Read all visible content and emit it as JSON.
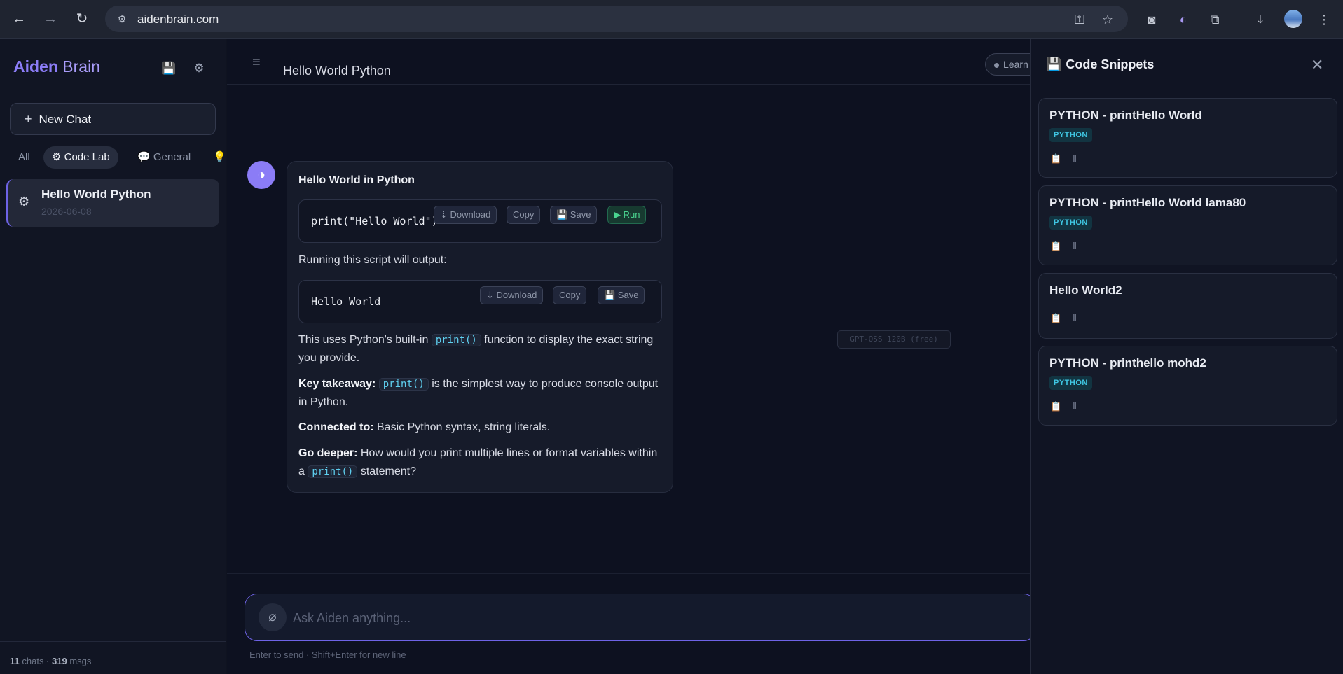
{
  "browser": {
    "url": "aidenbrain.com"
  },
  "sidebar": {
    "brand_bold": "Aiden",
    "brand_light": "Brain",
    "new_chat_label": "New Chat",
    "filters": [
      {
        "label": "All"
      },
      {
        "label": "⚙ Code Lab"
      },
      {
        "label": "💬 General"
      },
      {
        "label": "💡"
      }
    ],
    "chat_item": {
      "title": "Hello World Python",
      "date": "2026-06-08"
    },
    "stats_chats": "11",
    "stats_chats_label": "chats ·",
    "stats_msgs": "319",
    "stats_msgs_label": "msgs"
  },
  "main": {
    "chat_title": "Hello World Python",
    "learn_pill": "Learn",
    "message": {
      "heading": "Hello World in Python",
      "code1": "print(\"Hello World\")",
      "code1_buttons": {
        "download": "⇣ Download",
        "copy": "Copy",
        "save": "💾 Save",
        "run": "▶ Run"
      },
      "output_intro": "Running this script will output:",
      "code2": "Hello World",
      "code2_buttons": {
        "download": "⇣ Download",
        "copy": "Copy",
        "save": "💾 Save"
      },
      "p1_a": "This uses Python's built-in",
      "p1_code": "print()",
      "p1_b": "function to display the exact string you provide.",
      "p2_label": "Key takeaway:",
      "p2_code": "print()",
      "p2_b": "is the simplest way to produce console output in Python.",
      "p3_label": "Connected to:",
      "p3_b": "Basic Python syntax, string literals.",
      "p4_label": "Go deeper:",
      "p4_b": "How would you print multiple lines or format variables within a",
      "p4_code": "print()",
      "p4_c": "statement?"
    },
    "model_tag": "GPT-OSS 120B (free)",
    "composer": {
      "placeholder": "Ask Aiden anything..."
    },
    "hint": "Enter to send · Shift+Enter for new line"
  },
  "panel": {
    "title": "Code Snippets",
    "snippets": [
      {
        "title": "PYTHON - printHello World",
        "lang": "PYTHON"
      },
      {
        "title": "PYTHON - printHello World lama80",
        "lang": "PYTHON"
      },
      {
        "title": "Hello World2",
        "lang": ""
      },
      {
        "title": "PYTHON - printhello mohd2",
        "lang": "PYTHON"
      }
    ]
  },
  "icons": {
    "back": "back-arrow-icon",
    "forward": "forward-arrow-icon",
    "reload": "reload-icon",
    "save": "floppy-disk-icon",
    "settings": "gear-icon",
    "attach": "paperclip-icon",
    "close": "close-icon"
  },
  "colors": {
    "accent": "#8b7cf6",
    "run_green": "#4ad48f",
    "lang_cyan": "#3fc6e2"
  }
}
